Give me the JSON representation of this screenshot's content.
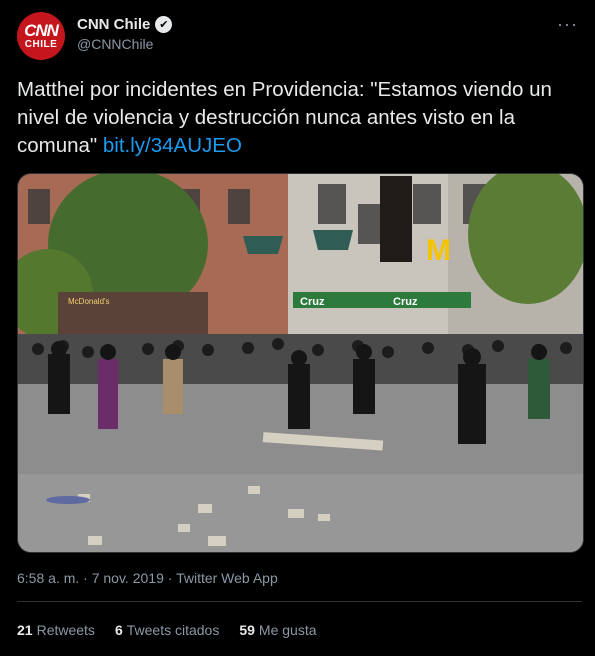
{
  "account": {
    "avatar_line1": "CNN",
    "avatar_line2": "CHILE",
    "display_name": "CNN Chile",
    "verified_icon": "✔",
    "handle": "@CNNChile",
    "more_icon": "···"
  },
  "tweet": {
    "text": "Matthei por incidentes en Providencia: \"Estamos viendo un nivel de violencia y destrucción nunca antes visto en la comuna\" ",
    "link": "bit.ly/34AUJEO"
  },
  "media": {
    "scene_signs": {
      "cruz_verde_left": "Cruz",
      "cruz_verde_right": "Cruz",
      "mcdonalds": "McDonald's"
    }
  },
  "meta": {
    "time": "6:58 a. m.",
    "sep": "·",
    "date": "7 nov. 2019",
    "source": "Twitter Web App"
  },
  "stats": {
    "retweets_count": "21",
    "retweets_label": "Retweets",
    "quotes_count": "6",
    "quotes_label": "Tweets citados",
    "likes_count": "59",
    "likes_label": "Me gusta"
  }
}
